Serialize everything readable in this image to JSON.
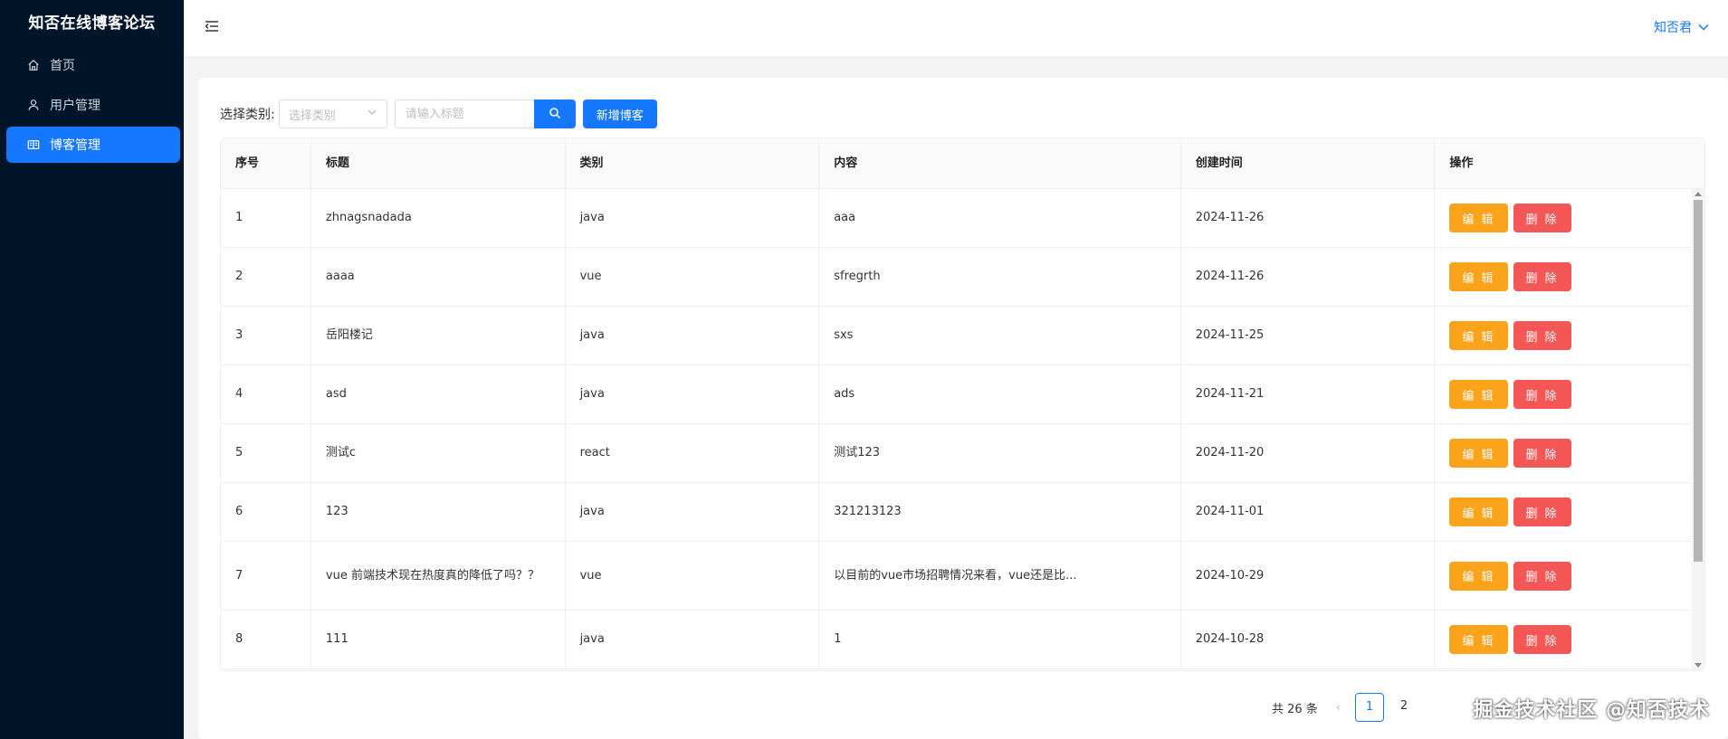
{
  "app": {
    "title": "知否在线博客论坛"
  },
  "sidebar": {
    "items": [
      {
        "label": "首页",
        "icon": "home-icon",
        "active": false
      },
      {
        "label": "用户管理",
        "icon": "user-icon",
        "active": false
      },
      {
        "label": "博客管理",
        "icon": "book-icon",
        "active": true
      }
    ]
  },
  "header": {
    "username": "知否君"
  },
  "toolbar": {
    "category_label": "选择类别:",
    "category_placeholder": "选择类别",
    "search_placeholder": "请输入标题",
    "add_label": "新增博客"
  },
  "table": {
    "columns": [
      "序号",
      "标题",
      "类别",
      "内容",
      "创建时间",
      "操作"
    ],
    "edit_label": "编 辑",
    "delete_label": "删 除",
    "rows": [
      {
        "no": "1",
        "title": "zhnagsnadada",
        "category": "java",
        "content": "aaa",
        "created": "2024-11-26"
      },
      {
        "no": "2",
        "title": "aaaa",
        "category": "vue",
        "content": "sfregrth",
        "created": "2024-11-26"
      },
      {
        "no": "3",
        "title": "岳阳楼记",
        "category": "java",
        "content": "sxs",
        "created": "2024-11-25"
      },
      {
        "no": "4",
        "title": "asd",
        "category": "java",
        "content": "ads",
        "created": "2024-11-21"
      },
      {
        "no": "5",
        "title": "测试c",
        "category": "react",
        "content": "测试123",
        "created": "2024-11-20"
      },
      {
        "no": "6",
        "title": "123",
        "category": "java",
        "content": "321213123",
        "created": "2024-11-01"
      },
      {
        "no": "7",
        "title": "vue 前端技术现在热度真的降低了吗？？",
        "category": "vue",
        "content": "以目前的vue市场招聘情况来看，vue还是比...",
        "created": "2024-10-29"
      },
      {
        "no": "8",
        "title": "111",
        "category": "java",
        "content": "1",
        "created": "2024-10-28"
      }
    ]
  },
  "pagination": {
    "total_text": "共 26 条",
    "pages": [
      "1",
      "2"
    ],
    "current": "1"
  },
  "watermark": "掘金技术社区 @知否技术",
  "colors": {
    "sidebar_bg": "#001529",
    "primary": "#1677ff",
    "edit": "#faa31b",
    "delete": "#f55656"
  }
}
